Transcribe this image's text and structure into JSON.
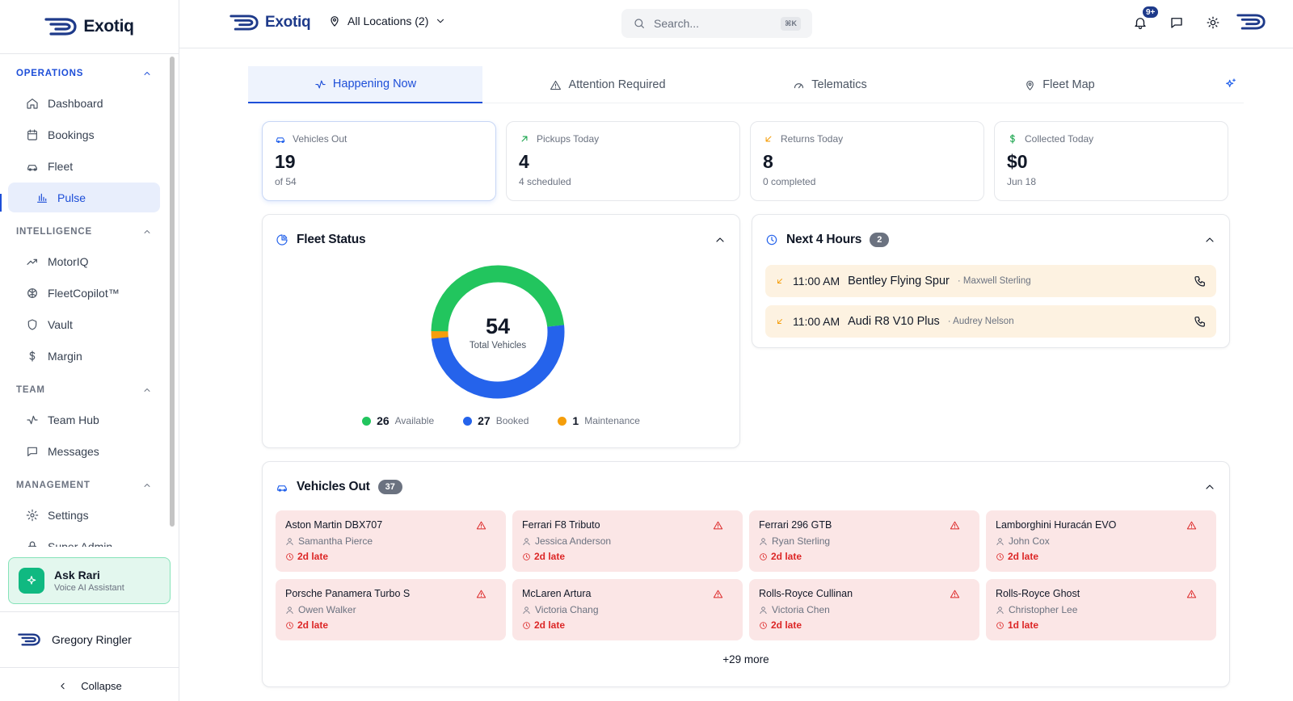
{
  "brand": {
    "name": "Exotiq"
  },
  "sidebar": {
    "sections": [
      {
        "title": "OPERATIONS",
        "items": [
          {
            "label": "Dashboard",
            "icon": "home-icon"
          },
          {
            "label": "Bookings",
            "icon": "calendar-icon"
          },
          {
            "label": "Fleet",
            "icon": "car-icon"
          },
          {
            "label": "Pulse",
            "icon": "bar-chart-icon",
            "active": true
          }
        ]
      },
      {
        "title": "INTELLIGENCE",
        "items": [
          {
            "label": "MotorIQ",
            "icon": "trending-up-icon"
          },
          {
            "label": "FleetCopilot™",
            "icon": "brain-icon"
          },
          {
            "label": "Vault",
            "icon": "shield-icon"
          },
          {
            "label": "Margin",
            "icon": "dollar-icon"
          }
        ]
      },
      {
        "title": "TEAM",
        "items": [
          {
            "label": "Team Hub",
            "icon": "activity-icon"
          },
          {
            "label": "Messages",
            "icon": "message-icon"
          }
        ]
      },
      {
        "title": "MANAGEMENT",
        "items": [
          {
            "label": "Settings",
            "icon": "gear-icon"
          },
          {
            "label": "Super Admin",
            "icon": "lock-icon"
          }
        ]
      }
    ],
    "assistant": {
      "title": "Ask Rari",
      "subtitle": "Voice AI Assistant"
    },
    "user": {
      "name": "Gregory Ringler"
    },
    "collapse_label": "Collapse"
  },
  "header": {
    "location": "All Locations (2)",
    "search_placeholder": "Search...",
    "search_shortcut": "⌘K",
    "notifications_badge": "9+"
  },
  "tabs": [
    {
      "label": "Happening Now",
      "icon": "activity-icon",
      "active": true
    },
    {
      "label": "Attention Required",
      "icon": "alert-triangle-icon"
    },
    {
      "label": "Telematics",
      "icon": "gauge-icon"
    },
    {
      "label": "Fleet Map",
      "icon": "map-pin-icon"
    }
  ],
  "stats": [
    {
      "label": "Vehicles Out",
      "value": "19",
      "sub": "of 54",
      "icon": "car-icon",
      "color": "#2563eb"
    },
    {
      "label": "Pickups Today",
      "value": "4",
      "sub": "4 scheduled",
      "icon": "arrow-up-right-icon",
      "color": "#16a34a"
    },
    {
      "label": "Returns Today",
      "value": "8",
      "sub": "0 completed",
      "icon": "arrow-down-left-icon",
      "color": "#f59e0b"
    },
    {
      "label": "Collected Today",
      "value": "$0",
      "sub": "Jun 18",
      "icon": "dollar-icon",
      "color": "#16a34a"
    }
  ],
  "fleet_status": {
    "title": "Fleet Status",
    "total": "54",
    "total_label": "Total Vehicles",
    "segments": [
      {
        "label": "Available",
        "value": 26,
        "color": "#22c55e"
      },
      {
        "label": "Booked",
        "value": 27,
        "color": "#2563eb"
      },
      {
        "label": "Maintenance",
        "value": 1,
        "color": "#f59e0b"
      }
    ]
  },
  "next_hours": {
    "title": "Next 4 Hours",
    "count": "2",
    "items": [
      {
        "time": "11:00 AM",
        "vehicle": "Bentley Flying Spur",
        "customer": "· Maxwell Sterling"
      },
      {
        "time": "11:00 AM",
        "vehicle": "Audi R8 V10 Plus",
        "customer": "· Audrey Nelson"
      }
    ]
  },
  "vehicles_out": {
    "title": "Vehicles Out",
    "count": "37",
    "more_label": "+29 more",
    "items": [
      {
        "vehicle": "Aston Martin DBX707",
        "customer": "Samantha Pierce",
        "status": "2d late"
      },
      {
        "vehicle": "Ferrari F8 Tributo",
        "customer": "Jessica Anderson",
        "status": "2d late"
      },
      {
        "vehicle": "Ferrari 296 GTB",
        "customer": "Ryan Sterling",
        "status": "2d late"
      },
      {
        "vehicle": "Lamborghini Huracán EVO",
        "customer": "John Cox",
        "status": "2d late"
      },
      {
        "vehicle": "Porsche Panamera Turbo S",
        "customer": "Owen Walker",
        "status": "2d late"
      },
      {
        "vehicle": "McLaren Artura",
        "customer": "Victoria Chang",
        "status": "2d late"
      },
      {
        "vehicle": "Rolls-Royce Cullinan",
        "customer": "Victoria Chen",
        "status": "2d late"
      },
      {
        "vehicle": "Rolls-Royce Ghost",
        "customer": "Christopher Lee",
        "status": "1d late"
      }
    ]
  }
}
